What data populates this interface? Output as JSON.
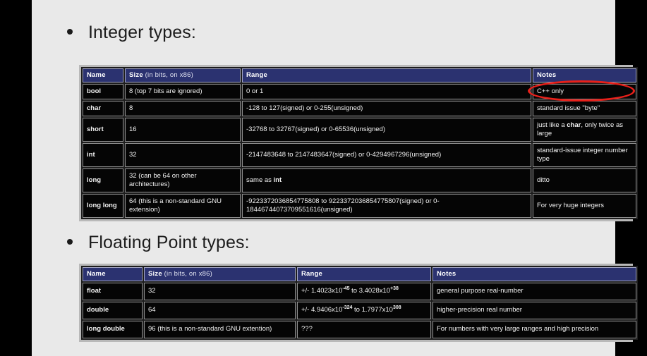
{
  "slide": {
    "background_color": "#e9e9e9",
    "frame_color": "#000000",
    "header_color": "#2b3270",
    "annotation_color": "#e8201a"
  },
  "bullets": {
    "integer": "Integer types:",
    "floating": "Floating Point types:"
  },
  "integer_table": {
    "headers": {
      "name": "Name",
      "size_main": "Size ",
      "size_sub": "(in bits, on x86)",
      "range": "Range",
      "notes": "Notes"
    },
    "rows": [
      {
        "name": "bool",
        "size": "8 (top 7 bits are ignored)",
        "range": "0 or 1",
        "notes": "C++ only"
      },
      {
        "name": "char",
        "size": "8",
        "range": "-128 to 127(signed) or 0-255(unsigned)",
        "notes": "standard issue \"byte\""
      },
      {
        "name": "short",
        "size": "16",
        "range": "-32768 to 32767(signed) or 0-65536(unsigned)",
        "notes_pre": "just like a ",
        "notes_bold": "char",
        "notes_post": ", only twice as large"
      },
      {
        "name": "int",
        "size": "32",
        "range": "-2147483648 to 2147483647(signed) or 0-4294967296(unsigned)",
        "notes": "standard-issue integer number type"
      },
      {
        "name": "long",
        "size": "32 (can be 64 on other architectures)",
        "range_pre": "same as ",
        "range_bold": "int",
        "notes": "ditto"
      },
      {
        "name": "long long",
        "size": "64 (this is a non-standard GNU extension)",
        "range": "-9223372036854775808 to 9223372036854775807(signed) or 0-18446744073709551616(unsigned)",
        "notes": "For very huge integers"
      }
    ]
  },
  "floating_table": {
    "headers": {
      "name": "Name",
      "size_main": "Size ",
      "size_sub": "(in bits, on x86)",
      "range": "Range",
      "notes": "Notes"
    },
    "rows": [
      {
        "name": "float",
        "size": "32",
        "range_parts": {
          "lead": "+/- 1.4023x10",
          "exp1": "-45",
          "mid": " to 3.4028x10",
          "exp2": "+38"
        },
        "notes": "general purpose real-number"
      },
      {
        "name": "double",
        "size": "64",
        "range_parts": {
          "lead": "+/- 4.9406x10",
          "exp1": "-324",
          "mid": " to 1.7977x10",
          "exp2": "308"
        },
        "notes": "higher-precision real number"
      },
      {
        "name": "long double",
        "size": "96 (this is a non-standard GNU extention)",
        "range_plain": "???",
        "notes": "For numbers with very large ranges and high precision"
      }
    ]
  },
  "annotation": {
    "target_label": "C++ only",
    "shape": "red-oval-highlight"
  }
}
